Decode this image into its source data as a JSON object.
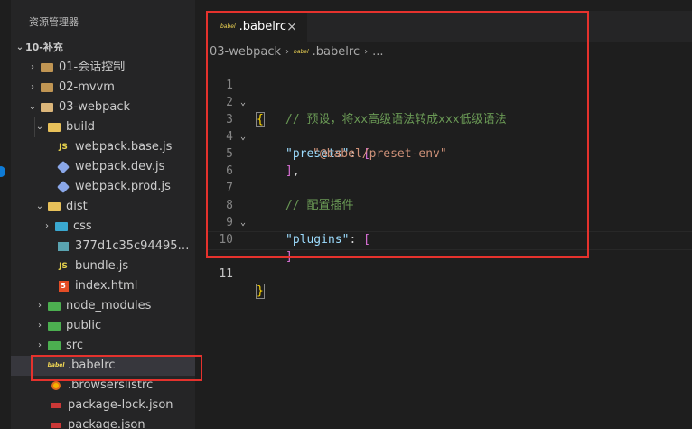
{
  "sidebar": {
    "title": "资源管理器",
    "section": "10-补充",
    "items": [
      {
        "label": "01-会话控制"
      },
      {
        "label": "02-mvvm"
      },
      {
        "label": "03-webpack"
      },
      {
        "label": "build"
      },
      {
        "label": "webpack.base.js"
      },
      {
        "label": "webpack.dev.js"
      },
      {
        "label": "webpack.prod.js"
      },
      {
        "label": "dist"
      },
      {
        "label": "css"
      },
      {
        "label": "377d1c35c944957c5..."
      },
      {
        "label": "bundle.js"
      },
      {
        "label": "index.html"
      },
      {
        "label": "node_modules"
      },
      {
        "label": "public"
      },
      {
        "label": "src"
      },
      {
        "label": ".babelrc"
      },
      {
        "label": ".browserslistrc"
      },
      {
        "label": "package-lock.json"
      },
      {
        "label": "package.json"
      }
    ]
  },
  "tab": {
    "label": ".babelrc",
    "close": "×",
    "icon_text": "babel"
  },
  "breadcrumb": {
    "folder": "03-webpack",
    "file": ".babelrc",
    "more": "..."
  },
  "editor": {
    "line_numbers": [
      "1",
      "2",
      "3",
      "4",
      "5",
      "6",
      "7",
      "8",
      "9",
      "10",
      "11"
    ],
    "l1_open": "{",
    "l2_comment": "// 预设，将xx高级语法转成xxx低级语法",
    "l3_key": "\"presets\"",
    "l3_colon": ": ",
    "l3_bracket": "[",
    "l4_str": "\"@babel/preset-env\"",
    "l5_bracket": "]",
    "l5_comma": ",",
    "l7_comment": "// 配置插件",
    "l8_key": "\"plugins\"",
    "l8_colon": ": ",
    "l8_bracket": "[",
    "l10_bracket": "]",
    "l11_close": "}"
  },
  "colors": {
    "highlight_box": "#e5322d",
    "accent": "#0e7bd6"
  }
}
